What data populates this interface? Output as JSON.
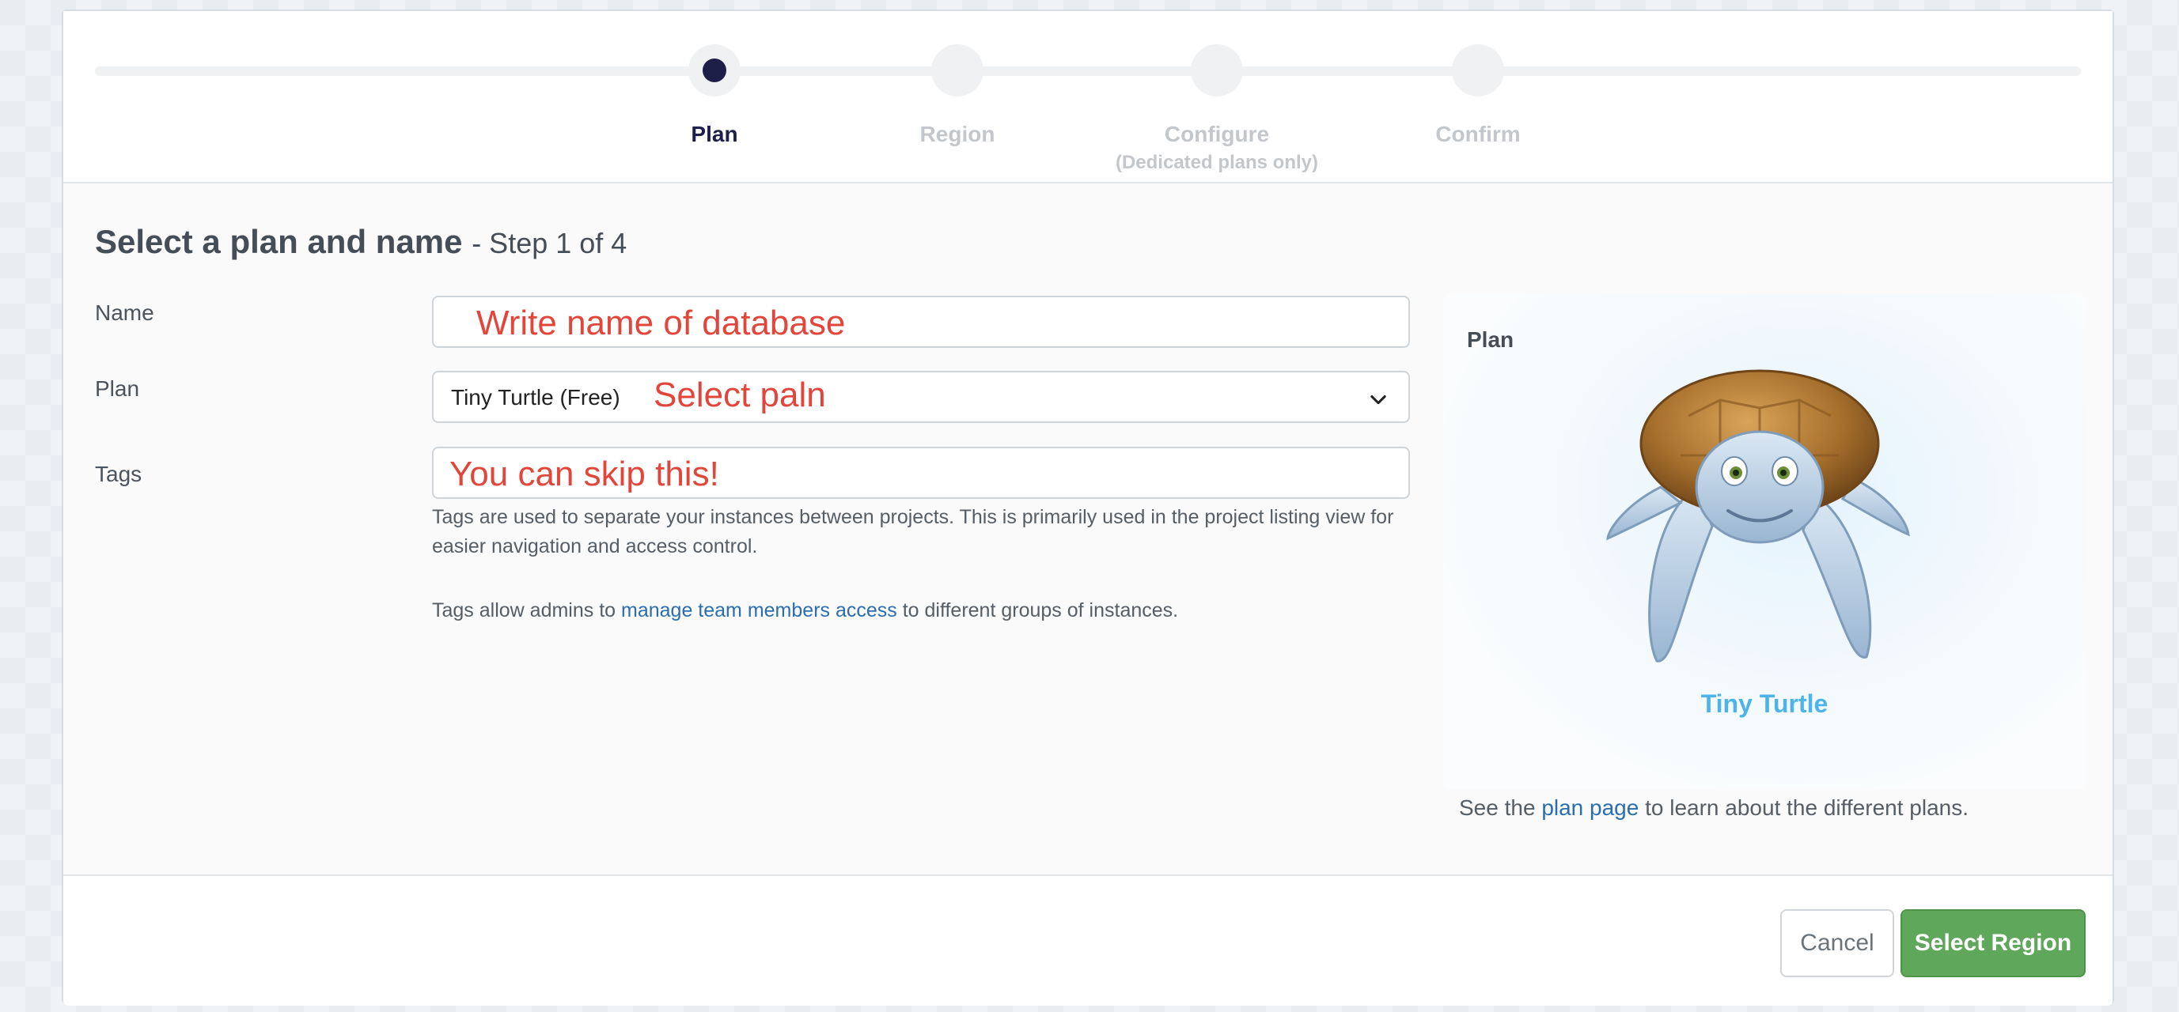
{
  "stepper": {
    "steps": [
      {
        "label": "Plan",
        "sublabel": ""
      },
      {
        "label": "Region",
        "sublabel": ""
      },
      {
        "label": "Configure",
        "sublabel": "(Dedicated plans only)"
      },
      {
        "label": "Confirm",
        "sublabel": ""
      }
    ],
    "active_index": 0
  },
  "form": {
    "title": "Select a plan and name",
    "step_text": "- Step 1 of 4",
    "name_label": "Name",
    "name_annotation": "Write name of database",
    "plan_label": "Plan",
    "plan_value": "Tiny Turtle (Free)",
    "plan_annotation": "Select paln",
    "tags_label": "Tags",
    "tags_annotation": "You can skip this!",
    "tags_help": "Tags are used to separate your instances between projects. This is primarily used in the project listing view for easier navigation and access control.",
    "tags_admin_prefix": "Tags allow admins to",
    "tags_admin_link": "manage team members access",
    "tags_admin_suffix": "to different groups of instances."
  },
  "plan_panel": {
    "heading": "Plan",
    "plan_name": "Tiny Turtle",
    "note_prefix": "See the",
    "note_link": "plan page",
    "note_suffix": "to learn about the different plans.",
    "image": "turtle-mascot"
  },
  "footer": {
    "cancel_label": "Cancel",
    "next_label": "Select Region"
  },
  "colors": {
    "active_step": "#1e1f48",
    "annotation": "#e2463b",
    "link": "#2a6db0",
    "plan_name": "#4cb4ea",
    "primary_button": "#5fa75a"
  }
}
